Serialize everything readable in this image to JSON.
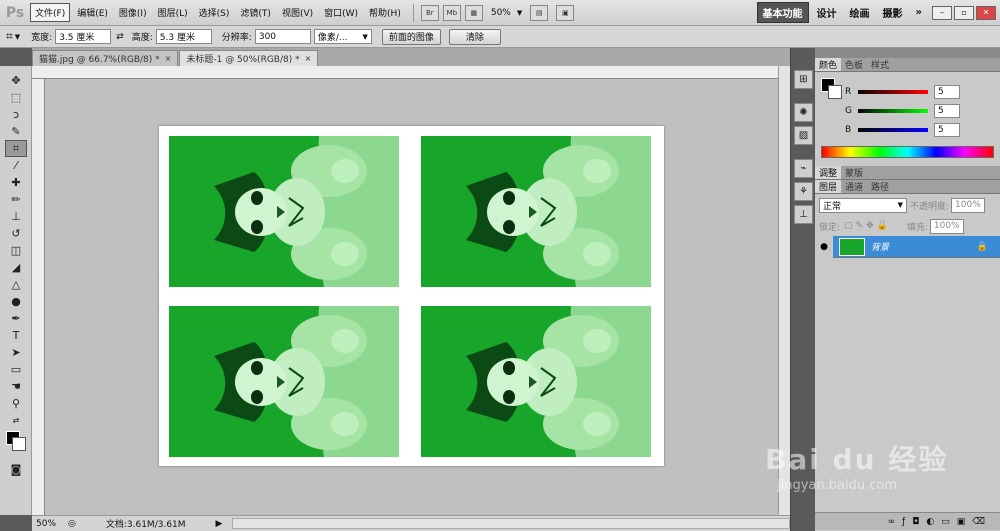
{
  "app_logo": "Ps",
  "menu": [
    "文件(F)",
    "编辑(E)",
    "图像(I)",
    "图层(L)",
    "选择(S)",
    "滤镜(T)",
    "视图(V)",
    "窗口(W)",
    "帮助(H)"
  ],
  "topbar": {
    "br_label": "Br",
    "mb_label": "Mb",
    "zoom_value": "50%",
    "workspaces": [
      "基本功能",
      "设计",
      "绘画",
      "摄影"
    ],
    "more_label": "»",
    "window_buttons": [
      "–",
      "▫",
      "✕"
    ]
  },
  "options": {
    "width_label": "宽度:",
    "width_value": "3.5 厘米",
    "height_label": "高度:",
    "height_value": "5.3 厘米",
    "resolution_label": "分辨率:",
    "resolution_value": "300",
    "unit_value": "像素/...",
    "front_image_button": "前面的图像",
    "clear_button": "清除"
  },
  "doc_tabs": [
    {
      "title": "猫猫.jpg @ 66.7%(RGB/8) *",
      "close": "×"
    },
    {
      "title": "未标题-1 @ 50%(RGB/8) *",
      "close": "×"
    }
  ],
  "status": {
    "zoom": "50%",
    "doc_info": "文档:3.61M/3.61M"
  },
  "color_panel": {
    "tabs": [
      "颜色",
      "色板",
      "样式"
    ],
    "rows": [
      {
        "label": "R",
        "value": "5",
        "gradient": "linear-gradient(90deg,#050505,#ff0505)"
      },
      {
        "label": "G",
        "value": "5",
        "gradient": "linear-gradient(90deg,#050505,#05ff05)"
      },
      {
        "label": "B",
        "value": "5",
        "gradient": "linear-gradient(90deg,#050505,#0505ff)"
      }
    ]
  },
  "adjust_tabs": [
    "调整",
    "蒙版"
  ],
  "layers_panel": {
    "tabs": [
      "图层",
      "通道",
      "路径"
    ],
    "blend_mode": "正常",
    "opacity_label": "不透明度:",
    "opacity_value": "100%",
    "lock_label": "锁定:",
    "fill_label": "填充:",
    "fill_value": "100%",
    "layer_name": "背景"
  },
  "watermark": {
    "text": "Bai du 经验",
    "url": "jingyan.baidu.com"
  },
  "colors": {
    "selection_blue": "#3b8bd6",
    "photo_green": "#17a52a",
    "canvas_gray": "#c0c0c0"
  }
}
